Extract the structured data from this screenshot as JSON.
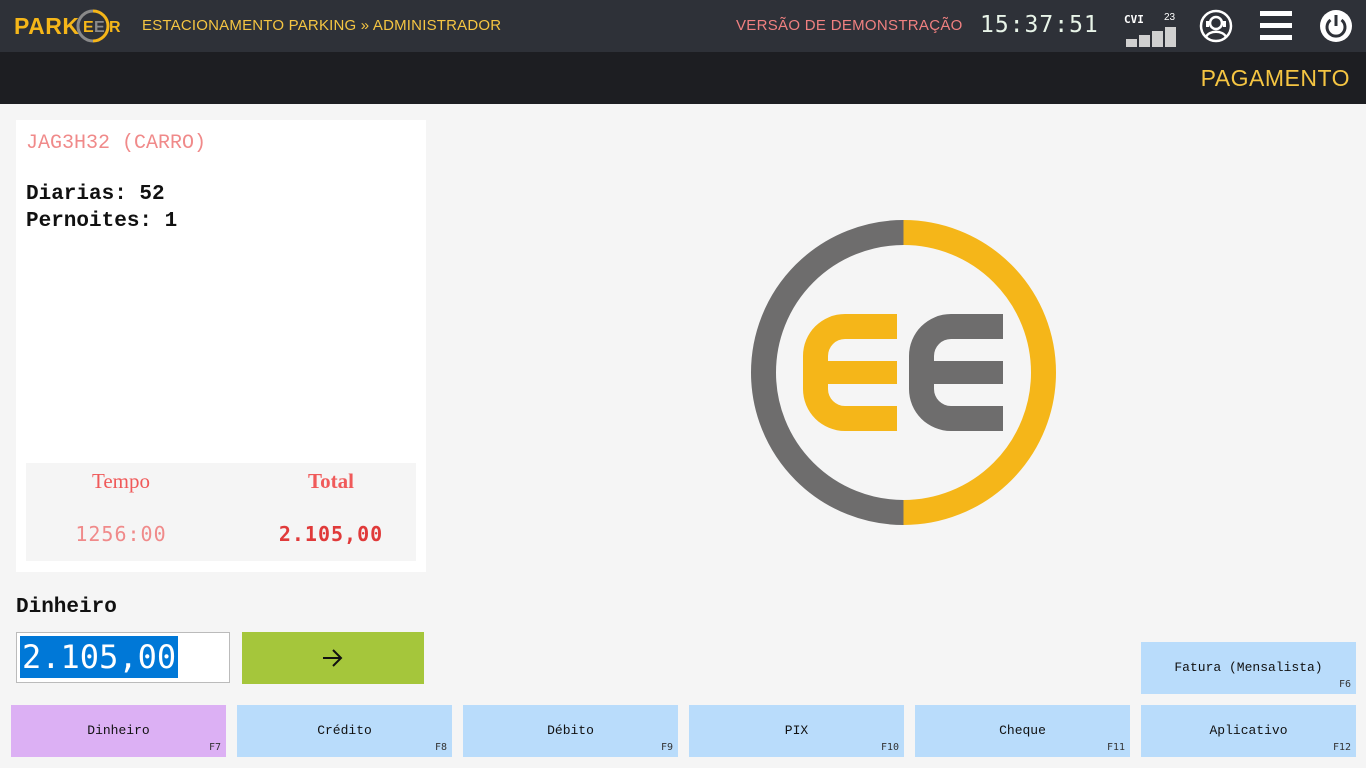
{
  "header": {
    "logo_text": "PARKEER",
    "logo_main": "PARK",
    "logo_ee": "EER",
    "title": "ESTACIONAMENTO PARKING » ADMINISTRADOR",
    "demo_label": "VERSÃO DE DEMONSTRAÇÃO",
    "clock": "15:37:51",
    "signal_label": "CVI",
    "signal_value": "23",
    "icons": [
      "user-support-icon",
      "menu-icon",
      "power-icon"
    ]
  },
  "subheader": {
    "page_title": "PAGAMENTO"
  },
  "vehicle": {
    "plate": "JAG3H32 (CARRO)",
    "diarias": "Diarias: 52",
    "pernoites": "Pernoites: 1"
  },
  "summary": {
    "tempo_label": "Tempo",
    "tempo_value": "1256:00",
    "total_label": "Total",
    "total_value": "2.105,00"
  },
  "payment": {
    "method_label": "Dinheiro",
    "amount": "2.105,00"
  },
  "buttons": {
    "fatura": {
      "label": "Fatura (Mensalista)",
      "key": "F6"
    },
    "dinheiro": {
      "label": "Dinheiro",
      "key": "F7"
    },
    "credito": {
      "label": "Crédito",
      "key": "F8"
    },
    "debito": {
      "label": "Débito",
      "key": "F9"
    },
    "pix": {
      "label": "PIX",
      "key": "F10"
    },
    "cheque": {
      "label": "Cheque",
      "key": "F11"
    },
    "aplicativo": {
      "label": "Aplicativo",
      "key": "F12"
    }
  },
  "colors": {
    "accent": "#f5b619",
    "gray": "#6e6d6d",
    "active_button": "#dcb0f4",
    "button": "#b9dcfb",
    "go_button": "#a5c63b"
  }
}
